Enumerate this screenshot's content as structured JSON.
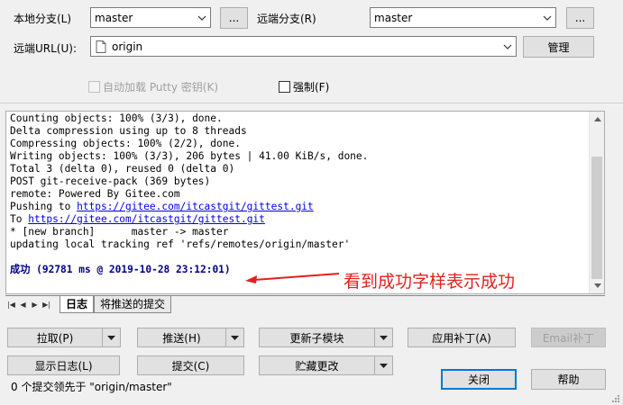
{
  "top": {
    "local_branch_label": "本地分支(L)",
    "local_branch_value": "master",
    "remote_branch_label": "远端分支(R)",
    "remote_branch_value": "master",
    "browse_label": "...",
    "remote_url_label": "远端URL(U):",
    "remote_url_value": "origin",
    "manage_label": "管理",
    "autoload_putty_label": "自动加载 Putty 密钥(K)",
    "force_label": "强制(F)"
  },
  "log": {
    "lines": [
      "Counting objects: 100% (3/3), done.",
      "Delta compression using up to 8 threads",
      "Compressing objects: 100% (2/2), done.",
      "Writing objects: 100% (3/3), 206 bytes | 41.00 KiB/s, done.",
      "Total 3 (delta 0), reused 0 (delta 0)",
      "POST git-receive-pack (369 bytes)",
      "remote: Powered By Gitee.com"
    ],
    "push_prefix": "Pushing to ",
    "push_url": "https://gitee.com/itcastgit/gittest.git",
    "to_prefix": "To ",
    "to_url": "https://gitee.com/itcastgit/gittest.git",
    "new_branch_line": "* [new branch]      master -> master",
    "tracking_line": "updating local tracking ref 'refs/remotes/origin/master'",
    "success_line": "成功 (92781 ms @ 2019-10-28 23:12:01)",
    "annotation": "看到成功字样表示成功",
    "annotation_color": "#e2221f"
  },
  "tabs": [
    {
      "label": "日志",
      "active": true
    },
    {
      "label": "将推送的提交",
      "active": false
    }
  ],
  "buttons": {
    "pull": "拉取(P)",
    "push": "推送(H)",
    "update_submodules": "更新子模块",
    "apply_patch": "应用补丁(A)",
    "email_patch": "Email补丁",
    "show_log": "显示日志(L)",
    "commit": "提交(C)",
    "stash": "贮藏更改",
    "close": "关闭",
    "help": "帮助"
  },
  "status": "0 个提交领先于 \"origin/master\""
}
